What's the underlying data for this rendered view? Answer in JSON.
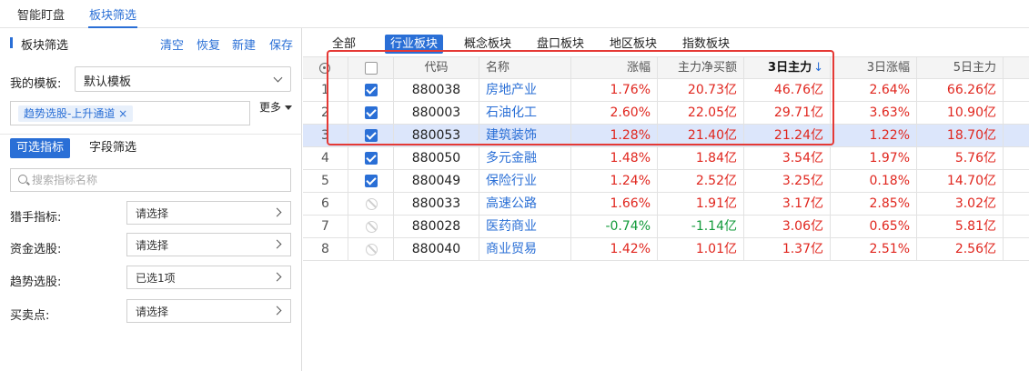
{
  "top_tabs": [
    "智能盯盘",
    "板块筛选"
  ],
  "left_panel": {
    "title": "板块筛选",
    "actions": [
      "清空",
      "恢复",
      "新建",
      "保存"
    ],
    "template_label": "我的模板:",
    "template_value": "默认模板",
    "tag": "趋势选股-上升通道 ×",
    "more_label": "更多",
    "sub_tabs": [
      "可选指标",
      "字段筛选"
    ],
    "search_placeholder": "搜索指标名称",
    "filters": [
      {
        "label": "猎手指标:",
        "value": "请选择"
      },
      {
        "label": "资金选股:",
        "value": "请选择"
      },
      {
        "label": "趋势选股:",
        "value": "已选1项"
      },
      {
        "label": "买卖点:",
        "value": "请选择"
      }
    ]
  },
  "category_tabs": [
    "全部",
    "行业板块",
    "概念板块",
    "盘口板块",
    "地区板块",
    "指数板块"
  ],
  "active_category": "行业板块",
  "table": {
    "headers": {
      "code": "代码",
      "name": "名称",
      "change": "涨幅",
      "net_main": "主力净买额",
      "main_3d": "3日主力",
      "sort_indicator": "↓",
      "change_3d": "3日涨幅",
      "main_5d": "5日主力"
    },
    "rows": [
      {
        "idx": "1",
        "check": "on",
        "code": "880038",
        "name": "房地产业",
        "change": "1.76%",
        "net_main": "20.73亿",
        "main_3d": "46.76亿",
        "change_3d": "2.64%",
        "main_5d": "66.26亿",
        "change_dir": "up",
        "net_dir": "up"
      },
      {
        "idx": "2",
        "check": "on",
        "code": "880003",
        "name": "石油化工",
        "change": "2.60%",
        "net_main": "22.05亿",
        "main_3d": "29.71亿",
        "change_3d": "3.63%",
        "main_5d": "10.90亿",
        "change_dir": "up",
        "net_dir": "up"
      },
      {
        "idx": "3",
        "check": "on",
        "code": "880053",
        "name": "建筑装饰",
        "change": "1.28%",
        "net_main": "21.40亿",
        "main_3d": "21.24亿",
        "change_3d": "1.22%",
        "main_5d": "18.70亿",
        "change_dir": "up",
        "net_dir": "up",
        "selected": true
      },
      {
        "idx": "4",
        "check": "on",
        "code": "880050",
        "name": "多元金融",
        "change": "1.48%",
        "net_main": "1.84亿",
        "main_3d": "3.54亿",
        "change_3d": "1.97%",
        "main_5d": "5.76亿",
        "change_dir": "up",
        "net_dir": "up"
      },
      {
        "idx": "5",
        "check": "on",
        "code": "880049",
        "name": "保险行业",
        "change": "1.24%",
        "net_main": "2.52亿",
        "main_3d": "3.25亿",
        "change_3d": "0.18%",
        "main_5d": "14.70亿",
        "change_dir": "up",
        "net_dir": "up"
      },
      {
        "idx": "6",
        "check": "ban",
        "code": "880033",
        "name": "高速公路",
        "change": "1.66%",
        "net_main": "1.91亿",
        "main_3d": "3.17亿",
        "change_3d": "2.85%",
        "main_5d": "3.02亿",
        "change_dir": "up",
        "net_dir": "up"
      },
      {
        "idx": "7",
        "check": "ban",
        "code": "880028",
        "name": "医药商业",
        "change": "-0.74%",
        "net_main": "-1.14亿",
        "main_3d": "3.06亿",
        "change_3d": "0.65%",
        "main_5d": "5.81亿",
        "change_dir": "down",
        "net_dir": "down"
      },
      {
        "idx": "8",
        "check": "ban",
        "code": "880040",
        "name": "商业贸易",
        "change": "1.42%",
        "net_main": "1.01亿",
        "main_3d": "1.37亿",
        "change_3d": "2.51%",
        "main_5d": "2.56亿",
        "change_dir": "up",
        "net_dir": "up"
      }
    ]
  },
  "colors": {
    "accent": "#2a6fd6",
    "up": "#e0261e",
    "down": "#129a3a",
    "highlight_box": "#e53935",
    "selected_row": "#dce6fb"
  },
  "icons": {
    "header_first_col": "target-icon",
    "checked": "checkbox-checked-icon",
    "unchecked": "checkbox-icon",
    "disabled": "ban-icon"
  }
}
